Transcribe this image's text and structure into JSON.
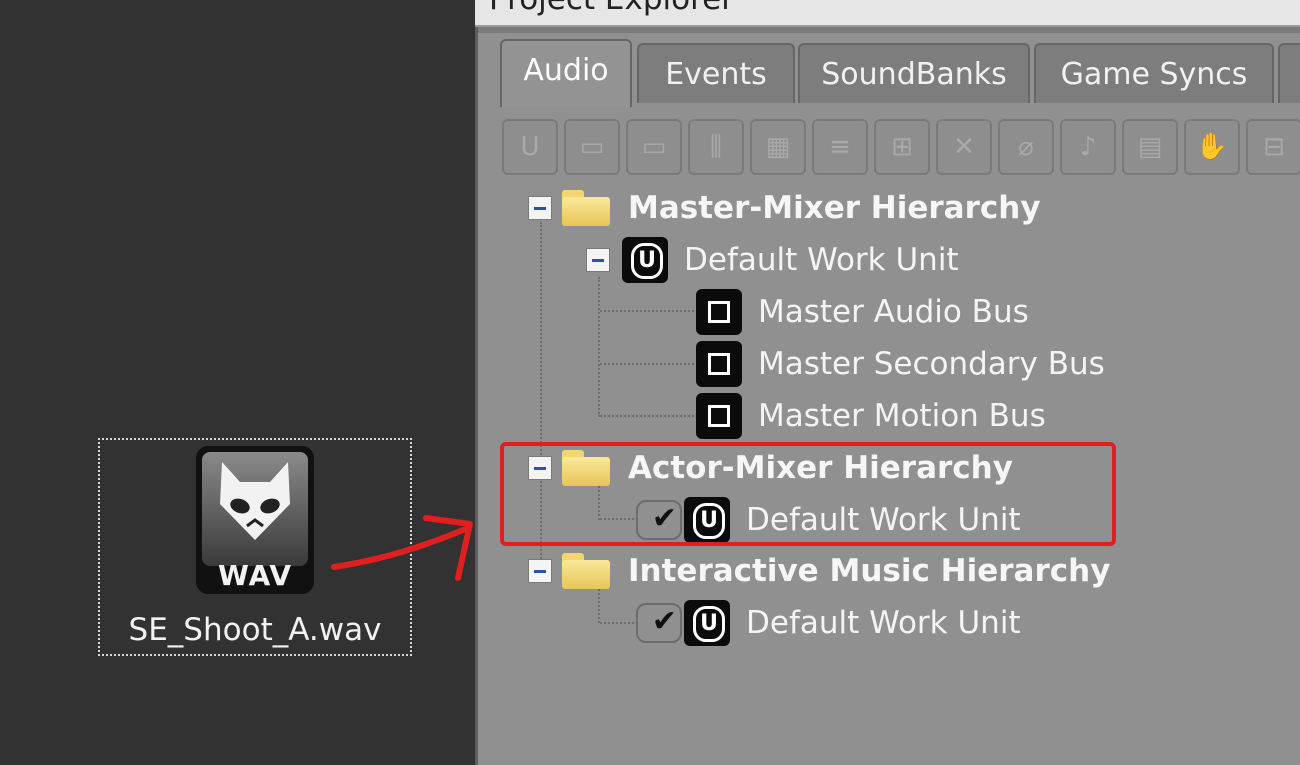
{
  "desktop": {
    "file_name": "SE_Shoot_A.wav",
    "file_badge": "WAV"
  },
  "panel": {
    "title": "Project Explorer",
    "tabs": [
      "Audio",
      "Events",
      "SoundBanks",
      "Game Syncs"
    ],
    "active_tab": "Audio"
  },
  "toolbar": {
    "buttons": [
      "work-unit",
      "folder",
      "folder-alt",
      "mixer",
      "grid",
      "list",
      "hierarchy",
      "switch",
      "motion",
      "voice",
      "bus",
      "effect",
      "settings"
    ]
  },
  "tree": {
    "master_mixer": {
      "label": "Master-Mixer Hierarchy",
      "work_unit": "Default Work Unit",
      "children": [
        "Master Audio Bus",
        "Master Secondary Bus",
        "Master Motion Bus"
      ]
    },
    "actor_mixer": {
      "label": "Actor-Mixer Hierarchy",
      "work_unit": "Default Work Unit",
      "checkmark": "✔"
    },
    "interactive_music": {
      "label": "Interactive Music Hierarchy",
      "work_unit": "Default Work Unit",
      "checkmark": "✔"
    }
  },
  "annotation": {
    "color": "#e02020"
  }
}
